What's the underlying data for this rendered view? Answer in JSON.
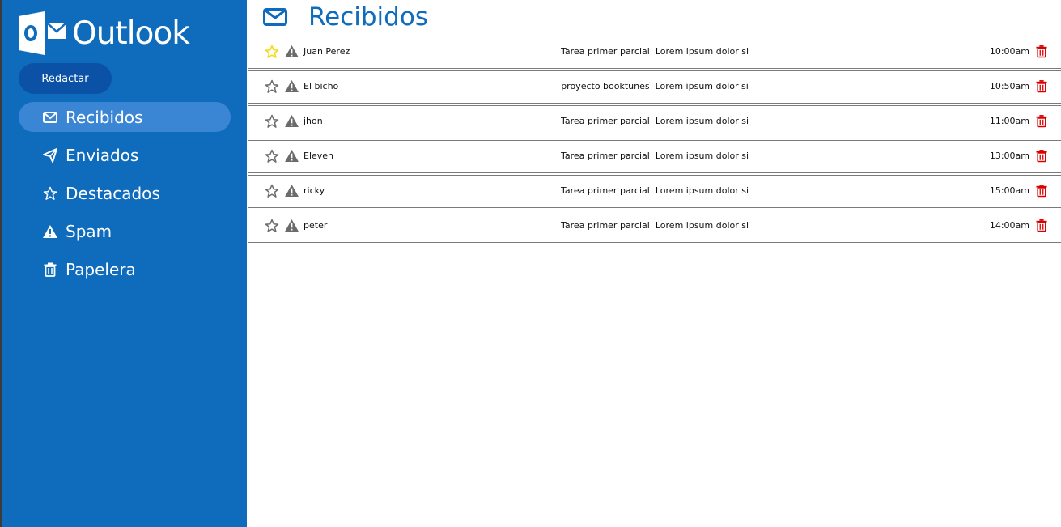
{
  "app": {
    "logo_letter": "O",
    "logo_text": "Outlook"
  },
  "sidebar": {
    "compose_label": "Redactar",
    "items": [
      {
        "label": "Recibidos",
        "icon": "envelope-icon",
        "active": true
      },
      {
        "label": "Enviados",
        "icon": "paper-plane-icon",
        "active": false
      },
      {
        "label": "Destacados",
        "icon": "star-icon",
        "active": false
      },
      {
        "label": "Spam",
        "icon": "warning-icon",
        "active": false
      },
      {
        "label": "Papelera",
        "icon": "trash-icon",
        "active": false
      }
    ]
  },
  "main": {
    "title": "Recibidos",
    "emails": [
      {
        "sender": "Juan Perez",
        "subject": "Tarea primer parcial",
        "preview": "Lorem ipsum dolor si",
        "time": "10:00am",
        "starred": true
      },
      {
        "sender": "El bicho",
        "subject": "proyecto booktunes",
        "preview": "Lorem ipsum dolor si",
        "time": "10:50am",
        "starred": false
      },
      {
        "sender": "jhon",
        "subject": "Tarea primer parcial",
        "preview": "Lorem ipsum dolor si",
        "time": "11:00am",
        "starred": false
      },
      {
        "sender": "Eleven",
        "subject": "Tarea primer parcial",
        "preview": "Lorem ipsum dolor si",
        "time": "13:00am",
        "starred": false
      },
      {
        "sender": "ricky",
        "subject": "Tarea primer parcial",
        "preview": "Lorem ipsum dolor si",
        "time": "15:00am",
        "starred": false
      },
      {
        "sender": "peter",
        "subject": "Tarea primer parcial",
        "preview": "Lorem ipsum dolor si",
        "time": "14:00am",
        "starred": false
      }
    ]
  },
  "colors": {
    "sidebar": "#0f6cbd",
    "active": "#3b86d4",
    "compose": "#0b52a6",
    "accent": "#0f6cbd",
    "star_active": "#f5d90a",
    "trash": "#d90000",
    "warning": "#6b6b6b"
  }
}
